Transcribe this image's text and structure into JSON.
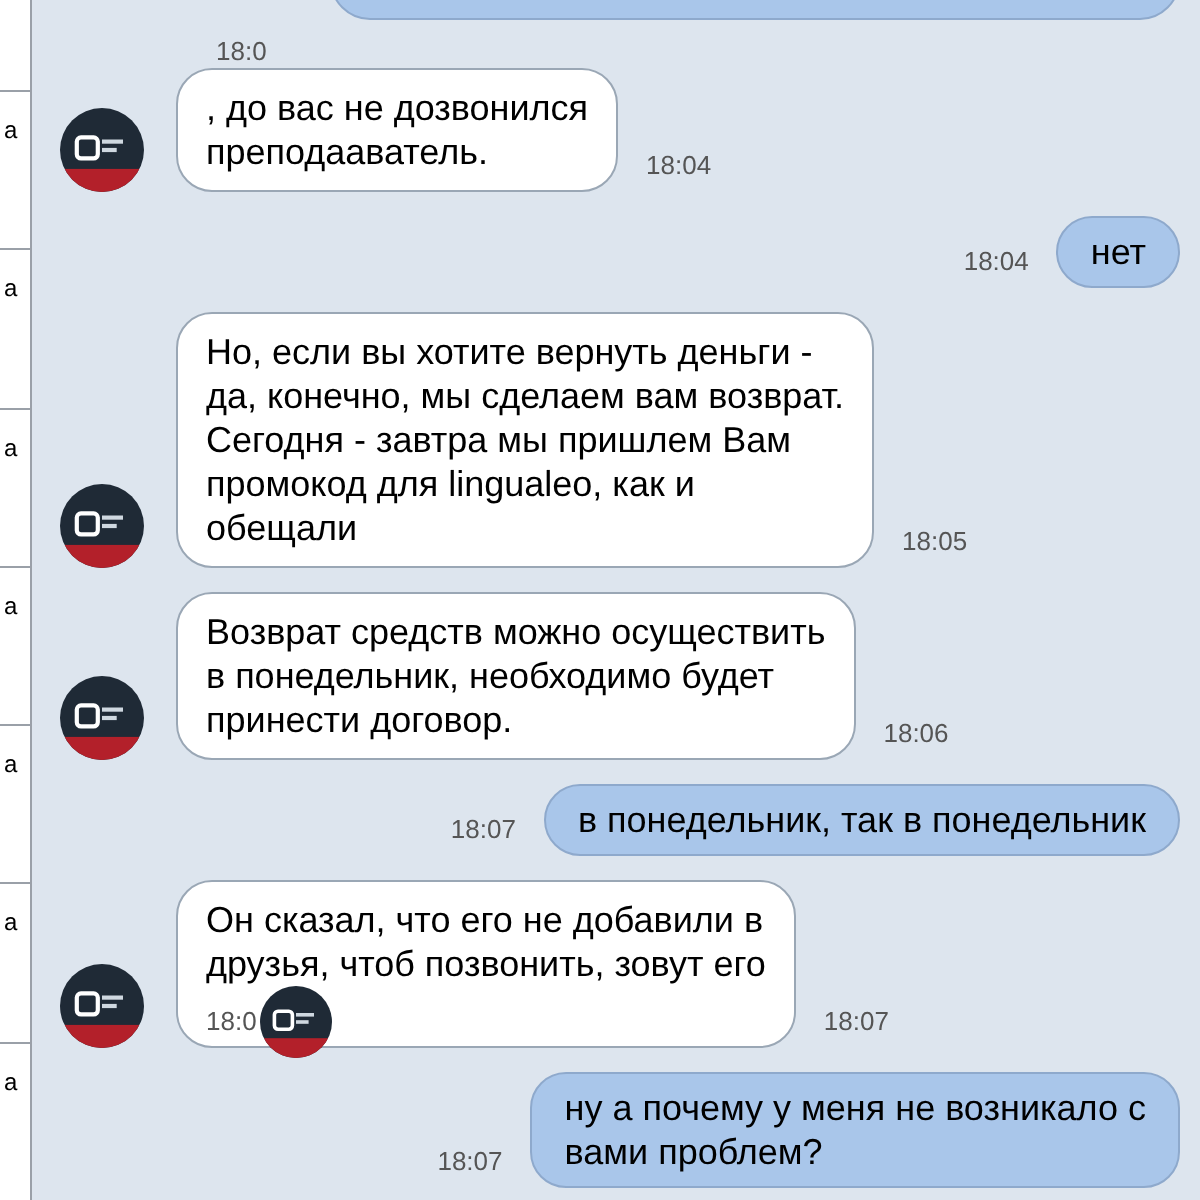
{
  "sidebar": {
    "items": [
      {
        "label": "а"
      },
      {
        "label": "а"
      },
      {
        "label": "а"
      },
      {
        "label": "а"
      },
      {
        "label": "а"
      },
      {
        "label": "а"
      },
      {
        "label": "а"
      }
    ]
  },
  "messages": [
    {
      "kind": "out_cut"
    },
    {
      "kind": "time",
      "time": "18:0"
    },
    {
      "kind": "in",
      "text": ", до вас не дозвонился\nпреподааватель.",
      "time": "18:04"
    },
    {
      "kind": "out",
      "text": "нет",
      "time": "18:04"
    },
    {
      "kind": "in",
      "text": "Но, если вы хотите вернуть деньги -\nда, конечно, мы сделаем вам возврат.\nСегодня - завтра мы пришлем Вам\nпромокод для lingualeo, как и\nобещали",
      "time": "18:05"
    },
    {
      "kind": "in",
      "text": "Возврат средств можно осуществить\nв понедельник, необходимо будет\nпринести договор.",
      "time": "18:06"
    },
    {
      "kind": "out",
      "text": "в понедельник, так в понедельник",
      "time": "18:07"
    },
    {
      "kind": "in",
      "text": "Он сказал, что его не добавили в\nдрузья, чтоб позвонить, зовут его",
      "time": "18:07",
      "overlay_time": "18:0"
    },
    {
      "kind": "out",
      "text": "ну а почему у меня не возникало с\nвами проблем?",
      "time": "18:07"
    }
  ]
}
